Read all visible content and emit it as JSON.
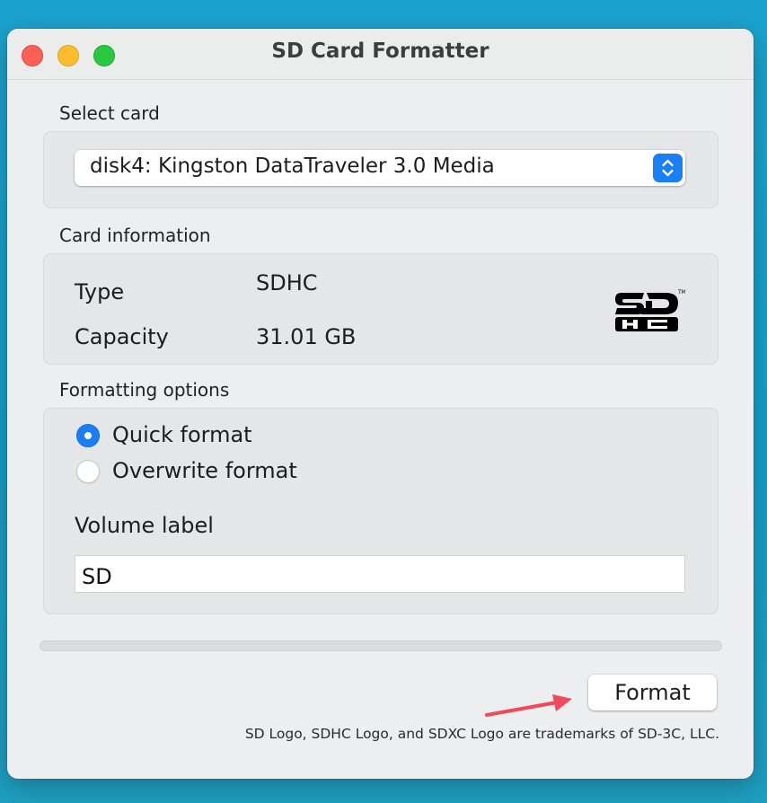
{
  "window": {
    "title": "SD Card Formatter"
  },
  "select_card": {
    "label": "Select card",
    "selected": "disk4: Kingston DataTraveler 3.0 Media"
  },
  "card_information": {
    "label": "Card information",
    "type_key": "Type",
    "type_value": "SDHC",
    "capacity_key": "Capacity",
    "capacity_value": "31.01 GB",
    "logo": "sdhc-logo"
  },
  "formatting_options": {
    "label": "Formatting options",
    "options": [
      {
        "label": "Quick format",
        "selected": true
      },
      {
        "label": "Overwrite format",
        "selected": false
      }
    ],
    "volume_label": "Volume label",
    "volume_value": "SD"
  },
  "progress": {
    "fraction": 0
  },
  "actions": {
    "format_label": "Format"
  },
  "footer": {
    "trademark": "SD Logo, SDHC Logo, and SDXC Logo are trademarks of SD-3C, LLC."
  },
  "colors": {
    "accent": "#1a7ef5",
    "annotation_arrow": "#f2495a"
  }
}
